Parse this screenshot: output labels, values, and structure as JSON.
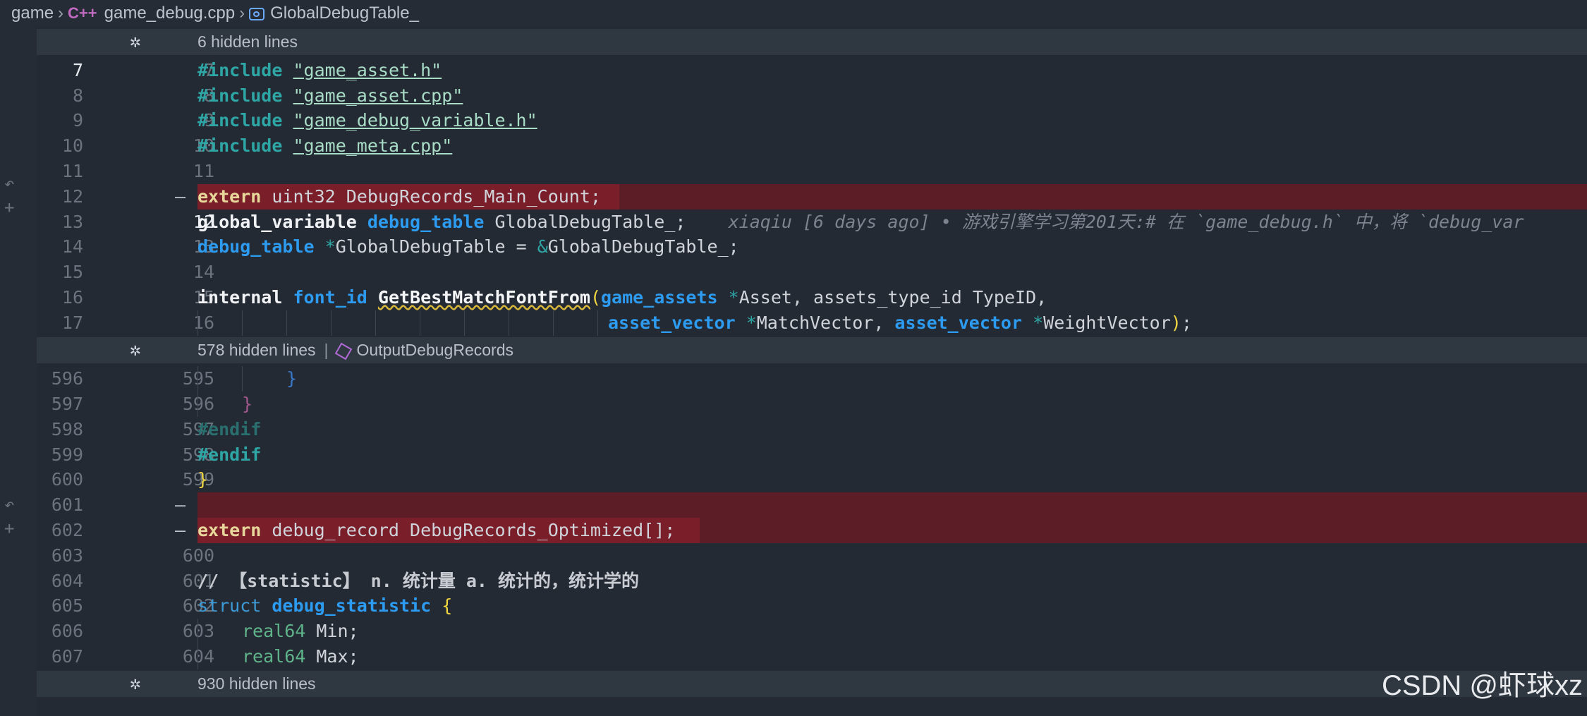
{
  "breadcrumb": {
    "folder": "game",
    "file_icon": "C++",
    "file": "game_debug.cpp",
    "symbol": "GlobalDebugTable_"
  },
  "hidden_bars": [
    {
      "text": "6 hidden lines"
    },
    {
      "text": "578 hidden lines",
      "symbol": "OutputDebugRecords"
    },
    {
      "text": "930 hidden lines"
    }
  ],
  "lines": [
    {
      "l1": "7",
      "l2": "7"
    },
    {
      "l1": "8",
      "l2": "8"
    },
    {
      "l1": "9",
      "l2": "9"
    },
    {
      "l1": "10",
      "l2": "10"
    },
    {
      "l1": "11",
      "l2": "11"
    },
    {
      "l1": "12",
      "l2": "—"
    },
    {
      "l1": "13",
      "l2": "12"
    },
    {
      "l1": "14",
      "l2": "13"
    },
    {
      "l1": "15",
      "l2": "14"
    },
    {
      "l1": "16",
      "l2": "15"
    },
    {
      "l1": "17",
      "l2": "16"
    },
    {
      "l1": "596",
      "l2": "595"
    },
    {
      "l1": "597",
      "l2": "596"
    },
    {
      "l1": "598",
      "l2": "597"
    },
    {
      "l1": "599",
      "l2": "598"
    },
    {
      "l1": "600",
      "l2": "599"
    },
    {
      "l1": "601",
      "l2": "—"
    },
    {
      "l1": "602",
      "l2": "—"
    },
    {
      "l1": "603",
      "l2": "600"
    },
    {
      "l1": "604",
      "l2": "601"
    },
    {
      "l1": "605",
      "l2": "602"
    },
    {
      "l1": "606",
      "l2": "603"
    },
    {
      "l1": "607",
      "l2": "604"
    }
  ],
  "code": {
    "include": "#include",
    "inc1": "\"game_asset.h\"",
    "inc2": "\"game_asset.cpp\"",
    "inc3": "\"game_debug_variable.h\"",
    "inc4": "\"game_meta.cpp\"",
    "extern": "extern",
    "l12_rest": " uint32 DebugRecords_Main_Count;",
    "global_variable": "global_variable",
    "debug_table": "debug_table",
    "l13_rest": " GlobalDebugTable_;",
    "blame": "xiaqiu [6 days ago] • 游戏引擎学习第201天:# 在 `game_debug.h` 中，将 `debug_var",
    "ptr": "*",
    "l14_rest": "GlobalDebugTable = ",
    "amp": "&",
    "l14_end": "GlobalDebugTable_;",
    "internal": "internal",
    "font_id": "font_id",
    "fn_name": "GetBestMatchFontFrom",
    "open_paren": "(",
    "game_assets": "game_assets",
    "l16_a": "Asset, assets_type_id TypeID,",
    "asset_vector": "asset_vector",
    "l17_a": "MatchVector, ",
    "l17_b": "WeightVector",
    "close_paren": ")",
    "semi": ";",
    "close_brace": "}",
    "endif": "#endif",
    "l602_rest": " debug_record DebugRecords_Optimized[];",
    "comment": "// 【statistic】 n. 统计量 a. 统计的，统计学的",
    "struct": "struct",
    "debug_statistic": "debug_statistic",
    "open_brace": "{",
    "real64": "real64",
    "min": " Min;",
    "max": " Max;"
  },
  "watermark": "CSDN @虾球xz",
  "colors": {
    "background": "#242a33",
    "deleted_line": "#5c1d26",
    "hidden_bar": "#2f3741",
    "keyword_type": "#2c9bf0",
    "preprocessor": "#2fa6a6"
  }
}
